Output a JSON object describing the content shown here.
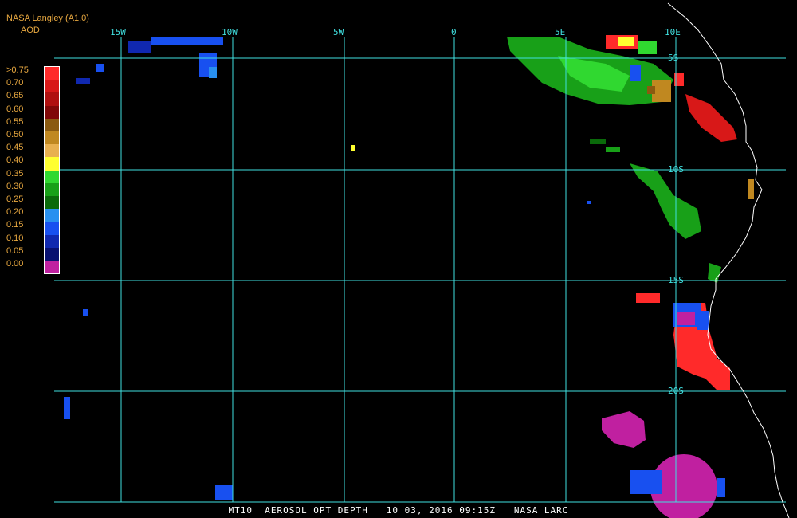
{
  "header": {
    "source": "NASA Langley (A1.0)",
    "product": "AOD"
  },
  "legend": {
    "levels": [
      {
        "label": ">0.75",
        "color": "#ff2a2a"
      },
      {
        "label": "0.70",
        "color": "#d81818"
      },
      {
        "label": "0.65",
        "color": "#b01010"
      },
      {
        "label": "0.60",
        "color": "#800808"
      },
      {
        "label": "0.55",
        "color": "#8a5a10"
      },
      {
        "label": "0.50",
        "color": "#c08820"
      },
      {
        "label": "0.45",
        "color": "#e8b050"
      },
      {
        "label": "0.40",
        "color": "#ffff30"
      },
      {
        "label": "0.35",
        "color": "#30d830"
      },
      {
        "label": "0.30",
        "color": "#18a018"
      },
      {
        "label": "0.25",
        "color": "#0a6a0a"
      },
      {
        "label": "0.20",
        "color": "#2890f0"
      },
      {
        "label": "0.15",
        "color": "#1850f0"
      },
      {
        "label": "0.10",
        "color": "#1028b0"
      },
      {
        "label": "0.05",
        "color": "#081070"
      },
      {
        "label": "0.00",
        "color": "#c020a0"
      }
    ]
  },
  "grid": {
    "longitude_labels": [
      "15W",
      "10W",
      "5W",
      "0",
      "5E",
      "10E"
    ],
    "latitude_labels": [
      "5S",
      "10S",
      "15S",
      "20S"
    ],
    "color": "#40e0e0"
  },
  "footer": {
    "caption": "MT10  AEROSOL OPT DEPTH   10 03, 2016 09:15Z   NASA LARC"
  },
  "colors": {
    "coastline": "#ffffff",
    "background": "#000000"
  }
}
